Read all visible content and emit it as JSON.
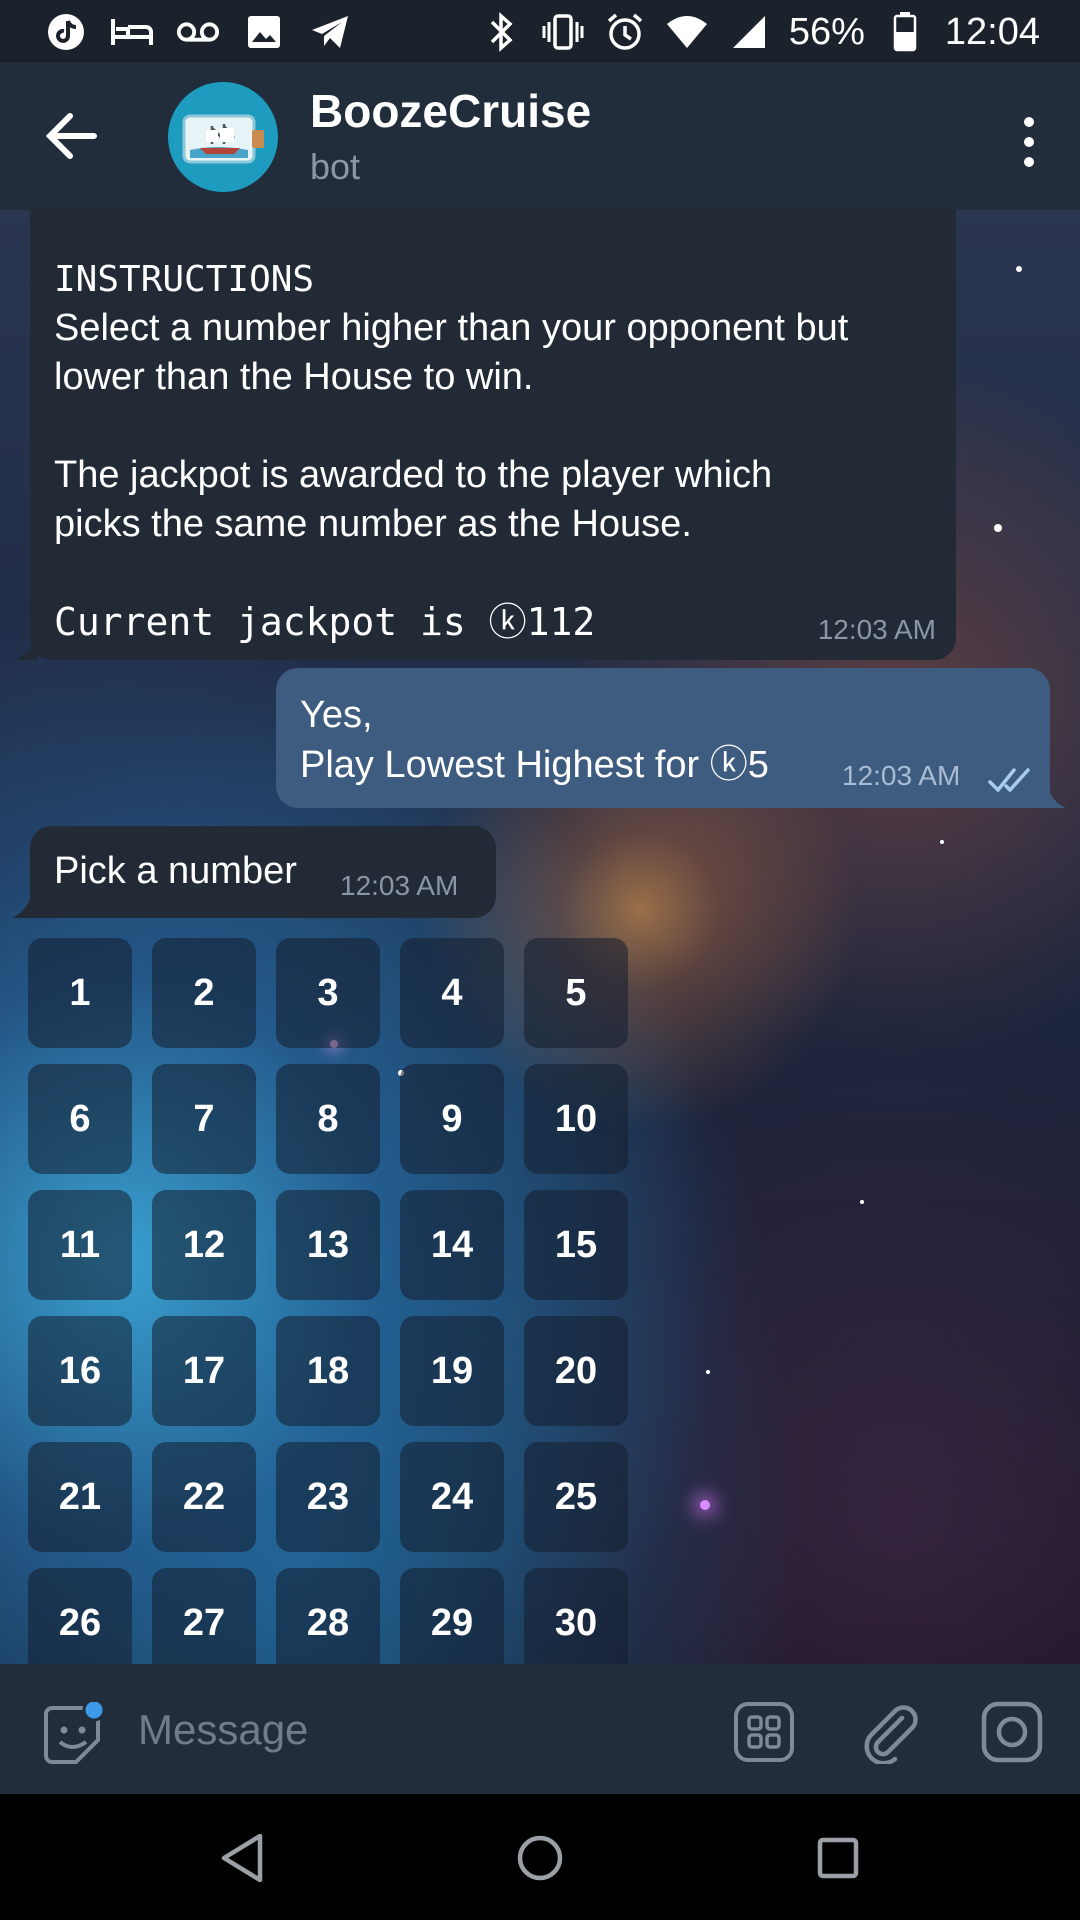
{
  "status_bar": {
    "battery": "56%",
    "time": "12:04",
    "left_icons": [
      "tiktok-icon",
      "bed-icon",
      "voicemail-icon",
      "image-icon",
      "telegram-icon"
    ],
    "right_icons": [
      "bluetooth-icon",
      "vibrate-icon",
      "alarm-icon",
      "wifi-icon",
      "signal-icon",
      "battery-icon"
    ]
  },
  "header": {
    "title": "BoozeCruise",
    "subtitle": "bot"
  },
  "messages": [
    {
      "direction": "in",
      "lines": [
        "INSTRUCTIONS",
        "Select a number higher than your opponent but",
        "lower than the House to win.",
        "",
        "The jackpot is awarded to the player which",
        "picks the same number as the House.",
        "",
        "Current jackpot is ⓚ112"
      ],
      "time": "12:03 AM"
    },
    {
      "direction": "out",
      "line1": "Yes,",
      "line2": "Play Lowest Highest for ⓚ5",
      "time": "12:03 AM",
      "read": true
    },
    {
      "direction": "in",
      "text": "Pick a number",
      "time": "12:03 AM"
    }
  ],
  "keyboard": [
    "1",
    "2",
    "3",
    "4",
    "5",
    "6",
    "7",
    "8",
    "9",
    "10",
    "11",
    "12",
    "13",
    "14",
    "15",
    "16",
    "17",
    "18",
    "19",
    "20",
    "21",
    "22",
    "23",
    "24",
    "25",
    "26",
    "27",
    "28",
    "29",
    "30"
  ],
  "input": {
    "placeholder": "Message"
  },
  "colors": {
    "header_bg": "#212d3b",
    "incoming_bubble": "#212a35",
    "outgoing_bubble": "#3e5b80",
    "accent": "#3d9ae8"
  }
}
